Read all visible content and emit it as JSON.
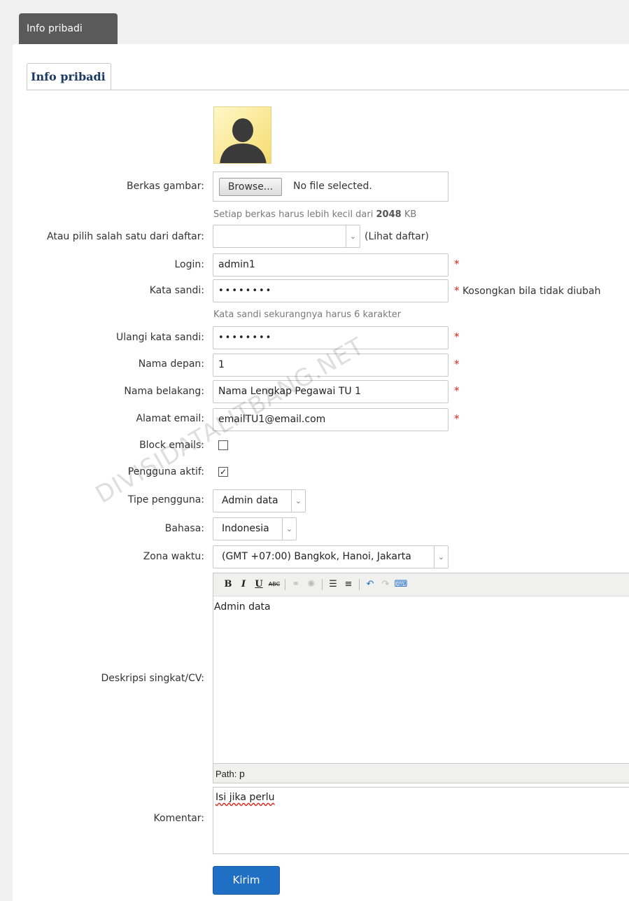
{
  "top_tab": "Info pribadi",
  "inner_tab": "Info pribadi",
  "form": {
    "image_file_label": "Berkas gambar:",
    "browse_label": "Browse...",
    "file_status": "No file selected.",
    "file_hint_prefix": "Setiap berkas harus lebih kecil dari ",
    "file_hint_size": "2048",
    "file_hint_unit": " KB",
    "choose_label": "Atau pilih salah satu dari daftar:",
    "choose_value": "",
    "choose_link": "(Lihat daftar)",
    "login_label": "Login:",
    "login_value": "admin1",
    "password_label": "Kata sandi:",
    "password_value": "••••••••",
    "password_note": "Kosongkan bila tidak diubah",
    "password_hint": "Kata sandi sekurangnya harus 6 karakter",
    "repeat_password_label": "Ulangi kata sandi:",
    "repeat_password_value": "••••••••",
    "first_name_label": "Nama depan:",
    "first_name_value": "1",
    "last_name_label": "Nama belakang:",
    "last_name_value": "Nama Lengkap Pegawai TU 1",
    "email_label": "Alamat email:",
    "email_value": "emailTU1@email.com",
    "block_emails_label": "Block emails:",
    "block_emails_checked": false,
    "active_user_label": "Pengguna aktif:",
    "active_user_checked": true,
    "user_type_label": "Tipe pengguna:",
    "user_type_value": "Admin data",
    "language_label": "Bahasa:",
    "language_value": "Indonesia",
    "timezone_label": "Zona waktu:",
    "timezone_value": "(GMT +07:00) Bangkok, Hanoi, Jakarta",
    "cv_label": "Deskripsi singkat/CV:",
    "cv_content": "Admin data",
    "path_label": "Path:",
    "path_value": "p",
    "comment_label": "Komentar:",
    "comment_value": "Isi jika perlu",
    "required_mark": "*",
    "submit_label": "Kirim"
  },
  "editor_toolbar": {
    "bold": "B",
    "italic": "I",
    "underline": "U",
    "strike": "ABC"
  },
  "watermark": "DIVISIDATALITBANG.NET",
  "colors": {
    "accent": "#1f6fc5",
    "required": "#d9261c",
    "tab_dark": "#5a5a5a",
    "inner_tab_text": "#1b3a66"
  }
}
